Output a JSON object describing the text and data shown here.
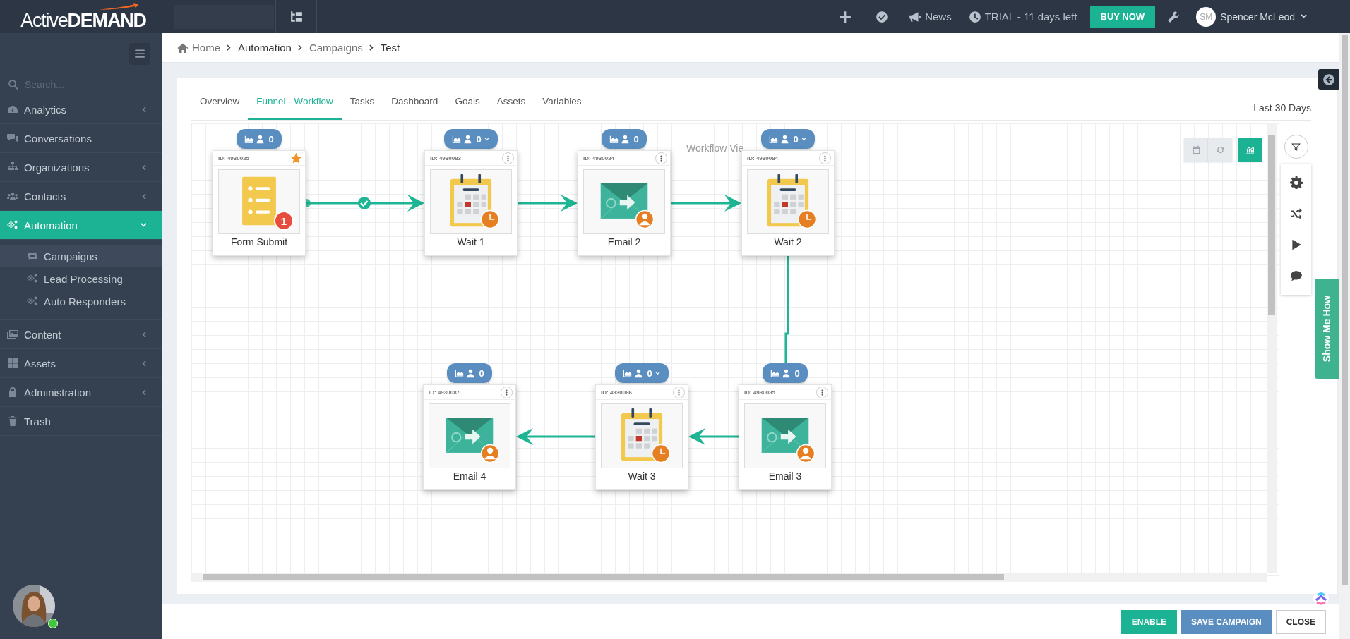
{
  "logo": {
    "text": "Active**DEMAND**"
  },
  "topbar": {
    "news": "News",
    "trial": "TRIAL - 11 days left",
    "buy_button": "BUY NOW",
    "user": {
      "initials": "SM",
      "name": "Spencer McLeod"
    }
  },
  "breadcrumb": [
    {
      "label": "Home",
      "link": true
    },
    {
      "label": "Automation",
      "link": false
    },
    {
      "label": "Campaigns",
      "link": true
    },
    {
      "label": "Test",
      "link": false
    }
  ],
  "sidebar": {
    "search_placeholder": "Search...",
    "items": [
      {
        "label": "Analytics",
        "has_submenu": true,
        "expanded": false,
        "selected": false
      },
      {
        "label": "Conversations",
        "has_submenu": false,
        "selected": false
      },
      {
        "label": "Organizations",
        "has_submenu": true,
        "expanded": false,
        "selected": false
      },
      {
        "label": "Contacts",
        "has_submenu": true,
        "expanded": false,
        "selected": false
      },
      {
        "label": "Automation",
        "has_submenu": true,
        "expanded": true,
        "selected": true,
        "children": [
          {
            "label": "Campaigns",
            "selected": true
          },
          {
            "label": "Lead Processing",
            "selected": false
          },
          {
            "label": "Auto Responders",
            "selected": false
          }
        ]
      },
      {
        "label": "Content",
        "has_submenu": true,
        "expanded": false,
        "selected": false
      },
      {
        "label": "Assets",
        "has_submenu": true,
        "expanded": false,
        "selected": false
      },
      {
        "label": "Administration",
        "has_submenu": true,
        "expanded": false,
        "selected": false
      },
      {
        "label": "Trash",
        "has_submenu": false,
        "selected": false
      }
    ],
    "avatar": {
      "online": true
    }
  },
  "tabs": [
    {
      "label": "Overview",
      "selected": false
    },
    {
      "label": "Funnel - Workflow",
      "selected": true
    },
    {
      "label": "Tasks",
      "selected": false
    },
    {
      "label": "Dashboard",
      "selected": false
    },
    {
      "label": "Goals",
      "selected": false
    },
    {
      "label": "Assets",
      "selected": false
    },
    {
      "label": "Variables",
      "selected": false
    }
  ],
  "range_label": "Last 30 Days",
  "canvas": {
    "watermark": "Workflow Vie",
    "toolbar": [
      {
        "selected": false
      },
      {
        "selected": false
      },
      {
        "selected": true
      }
    ],
    "nodes": [
      {
        "id": "ID: 4930025",
        "label": "Form Submit",
        "kind": "form",
        "count": "0",
        "dropdown": false,
        "starred": true,
        "number_badge": "1"
      },
      {
        "id": "ID: 4930083",
        "label": "Wait 1",
        "kind": "wait",
        "count": "0",
        "dropdown": true,
        "starred": false
      },
      {
        "id": "ID: 4930024",
        "label": "Email 2",
        "kind": "email",
        "count": "0",
        "dropdown": false,
        "starred": false
      },
      {
        "id": "ID: 4930084",
        "label": "Wait 2",
        "kind": "wait",
        "count": "0",
        "dropdown": true,
        "starred": false
      },
      {
        "id": "ID: 4930087",
        "label": "Email 4",
        "kind": "email",
        "count": "0",
        "dropdown": false,
        "starred": false
      },
      {
        "id": "ID: 4930086",
        "label": "Wait 3",
        "kind": "wait",
        "count": "0",
        "dropdown": true,
        "starred": false
      },
      {
        "id": "ID: 4930085",
        "label": "Email 3",
        "kind": "email",
        "count": "0",
        "dropdown": false,
        "starred": false
      }
    ]
  },
  "side_tab": "Show Me How",
  "footer": {
    "buttons": [
      {
        "label": "ENABLE",
        "kind": "primary"
      },
      {
        "label": "SAVE CAMPAIGN",
        "kind": "info"
      },
      {
        "label": "CLOSE",
        "kind": "default"
      }
    ]
  }
}
